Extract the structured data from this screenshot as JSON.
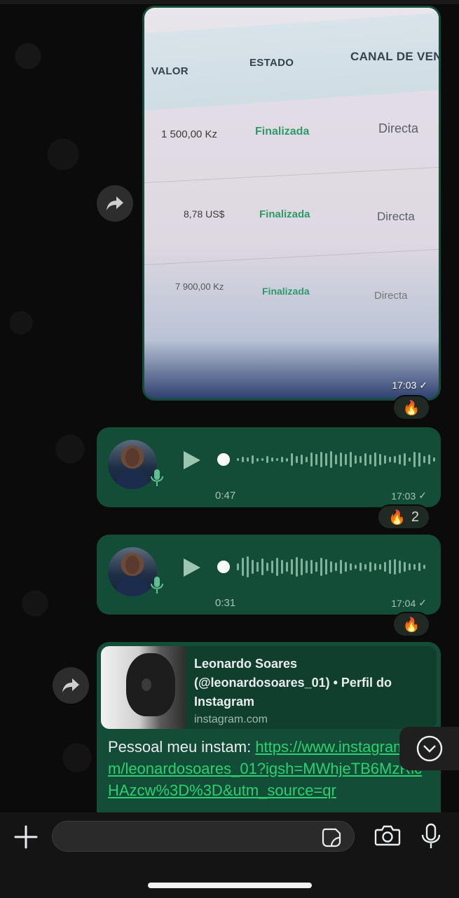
{
  "image_message": {
    "table": {
      "headers": [
        "VALOR",
        "ESTADO",
        "CANAL DE VEN"
      ],
      "rows": [
        {
          "valor": "1 500,00 Kz",
          "estado": "Finalizada",
          "canal": "Directa"
        },
        {
          "valor": "8,78 US$",
          "estado": "Finalizada",
          "canal": "Directa"
        },
        {
          "valor": "7 900,00 Kz",
          "estado": "Finalizada",
          "canal": "Directa"
        }
      ]
    },
    "time": "17:03",
    "reaction": "🔥"
  },
  "voice_messages": [
    {
      "duration": "0:47",
      "time": "17:03",
      "reaction": "🔥",
      "reaction_count": "2"
    },
    {
      "duration": "0:31",
      "time": "17:04",
      "reaction": "🔥"
    }
  ],
  "link_message": {
    "preview_title": "Leonardo Soares (@leonardosoares_01) • Perfil do Instagram",
    "preview_domain": "instagram.com",
    "text_prefix": "Pessoal meu instam: ",
    "url_text": "https://www.instagram.com/leonardosoares_01?igsh=MWhjeTB6MzRicHAzcw%3D%3D&utm_source=qr"
  },
  "input": {
    "placeholder": "",
    "value": ""
  },
  "icons": {
    "forward": "forward-icon",
    "mic": "mic-icon",
    "play": "play-icon",
    "camera": "camera-icon",
    "sticker": "sticker-icon",
    "plus": "plus-icon",
    "scroll": "chevron-down-icon"
  },
  "colors": {
    "bubble": "#144d37",
    "link": "#2ad16f",
    "status_green": "#2e9a6a"
  }
}
